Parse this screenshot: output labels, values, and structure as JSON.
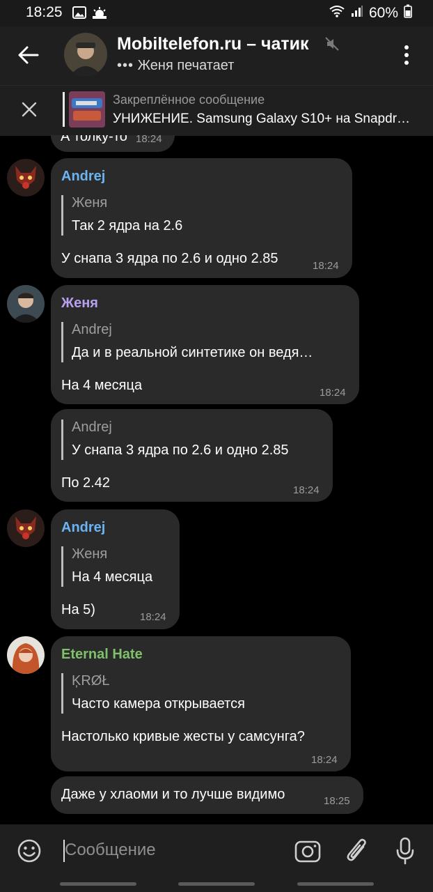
{
  "status": {
    "time": "18:25",
    "battery": "60%"
  },
  "header": {
    "title": "Mobiltelefon.ru – чатик",
    "typing_dots": "•••",
    "subtitle": "Женя печатает"
  },
  "pinned": {
    "title": "Закреплённое сообщение",
    "text": "УНИЖЕНИЕ. Samsung Galaxy S10+ на Snapdra…"
  },
  "partial": {
    "text": "А толку-то",
    "time": "18:24"
  },
  "messages": [
    {
      "sender": "Andrej",
      "sender_color": "#6cb3f2",
      "quote_name": "Женя",
      "quote_text": "Так 2 ядра на 2.6",
      "text": "У снапа 3 ядра по 2.6 и одно 2.85",
      "time": "18:24"
    },
    {
      "sender": "Женя",
      "sender_color": "#b9a0ef",
      "quote_name": "Andrej",
      "quote_text": "Да и в реальной синтетике он ведя…",
      "text": "На 4 месяца",
      "time": "18:24"
    },
    {
      "quote_name": "Andrej",
      "quote_text": "У снапа 3 ядра по 2.6 и одно 2.85",
      "text": "По 2.42",
      "time": "18:24"
    },
    {
      "sender": "Andrej",
      "sender_color": "#6cb3f2",
      "quote_name": "Женя",
      "quote_text": "На 4 месяца",
      "text": "На 5)",
      "time": "18:24"
    },
    {
      "sender": "Eternal Hate",
      "sender_color": "#7fc16b",
      "quote_name": "ĶRØŁ",
      "quote_text": "Часто камера открывается",
      "text": "Настолько кривые жесты у самсунга?",
      "time": "18:24"
    },
    {
      "text": "Даже у хлаоми и то лучше видимо",
      "time": "18:25"
    }
  ],
  "input": {
    "placeholder": "Сообщение"
  },
  "icons": [
    "back-arrow-icon",
    "mute-icon",
    "more-icon",
    "close-icon",
    "emoji-icon",
    "camera-icon",
    "attach-icon",
    "mic-icon"
  ]
}
